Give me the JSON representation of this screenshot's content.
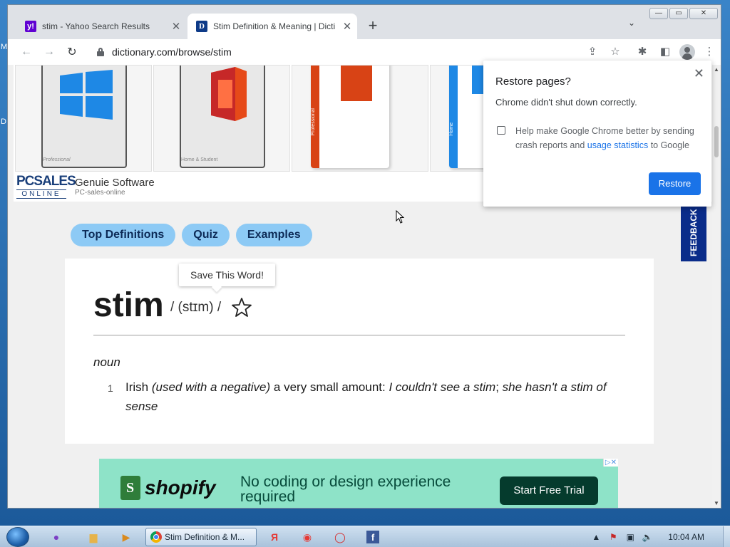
{
  "desktop": {
    "left_labels": [
      "M",
      "D"
    ]
  },
  "browser": {
    "tabs": [
      {
        "favicon": "yahoo-icon",
        "favicon_text": "y!",
        "title": "stim - Yahoo Search Results",
        "active": false
      },
      {
        "favicon": "dictionary-icon",
        "favicon_text": "D",
        "title": "Stim Definition & Meaning | Dicti",
        "active": true
      }
    ],
    "new_tab_label": "+",
    "window_controls": {
      "minimize": "—",
      "maximize": "▭",
      "close": "✕"
    },
    "url": "dictionary.com/browse/stim"
  },
  "ad_strip": {
    "brand_logo_line1": "PCSALES",
    "brand_logo_line2": "ONLINE",
    "brand_name": "Genuie Software",
    "brand_sub": "PC-sales-online",
    "products": [
      {
        "caption": "Professional",
        "kind": "windows"
      },
      {
        "caption": "Home & Student",
        "kind": "office"
      },
      {
        "caption": "Professional",
        "kind": "office-box"
      },
      {
        "caption": "Home",
        "kind": "windows-box"
      }
    ]
  },
  "nav_pills": [
    "Top Definitions",
    "Quiz",
    "Examples"
  ],
  "feedback_label": "FEEDBACK",
  "definition": {
    "tooltip": "Save This Word!",
    "word": "stim",
    "pronunciation": "/ (stɪm) /",
    "part_of_speech": "noun",
    "number": "1",
    "label": "Irish",
    "qualifier": "(used with a negative)",
    "meaning": " a very small amount: ",
    "example": "I couldn't see a stim",
    "separator": "; ",
    "example2": "she hasn't a stim of sense"
  },
  "shopify_ad": {
    "logo_letter": "S",
    "logo_word": "shopify",
    "message": "No coding or design experience required",
    "cta": "Start Free Trial",
    "ad_choices": "▷✕"
  },
  "restore_dialog": {
    "title": "Restore pages?",
    "message": "Chrome didn't shut down correctly.",
    "option_text_before": "Help make Google Chrome better by sending crash reports and ",
    "option_link": "usage statistics",
    "option_text_after": " to Google",
    "checked": false,
    "button": "Restore"
  },
  "taskbar": {
    "active_window": "Stim Definition & M...",
    "clock": "10:04 AM",
    "apps": [
      "tor-icon",
      "explorer-icon",
      "media-player-icon",
      "yandex-icon",
      "yandex-browser-icon",
      "opera-icon",
      "facebook-icon"
    ]
  }
}
